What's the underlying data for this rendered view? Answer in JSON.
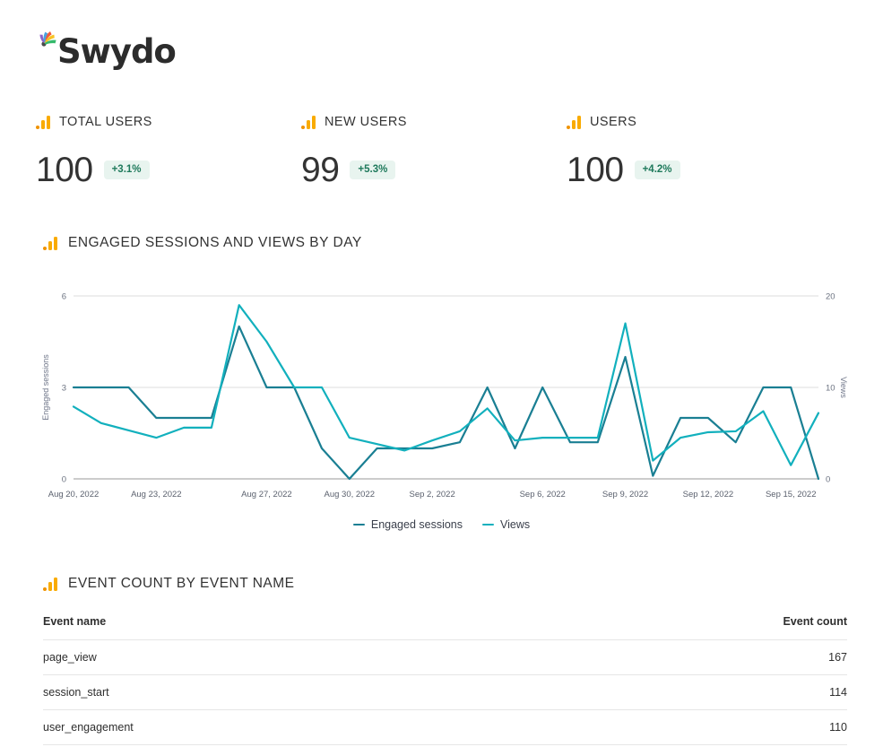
{
  "brand": {
    "name": "Swydo"
  },
  "kpis": [
    {
      "icon": "ga4-bar-icon",
      "title": "TOTAL USERS",
      "value": "100",
      "delta": "+3.1%"
    },
    {
      "icon": "ga4-bar-icon",
      "title": "NEW USERS",
      "value": "99",
      "delta": "+5.3%"
    },
    {
      "icon": "ga4-bar-icon",
      "title": "USERS",
      "value": "100",
      "delta": "+4.2%"
    }
  ],
  "chart_section": {
    "icon": "ga4-bar-icon",
    "title": "ENGAGED SESSIONS AND VIEWS BY DAY"
  },
  "table_section": {
    "icon": "ga4-bar-icon",
    "title": "EVENT COUNT BY EVENT NAME"
  },
  "chart_data": {
    "type": "line",
    "title": "Engaged sessions and views by day",
    "xlabel": "",
    "ylabel": "Engaged sessions",
    "y2label": "Views",
    "ylim": [
      0,
      6
    ],
    "y2lim": [
      0,
      20
    ],
    "yticks": [
      "0",
      "3",
      "6"
    ],
    "y2ticks": [
      "0",
      "10",
      "20"
    ],
    "grid": true,
    "legend_position": "bottom",
    "x": [
      "Aug 20, 2022",
      "Aug 21, 2022",
      "Aug 22, 2022",
      "Aug 23, 2022",
      "Aug 24, 2022",
      "Aug 25, 2022",
      "Aug 26, 2022",
      "Aug 27, 2022",
      "Aug 28, 2022",
      "Aug 29, 2022",
      "Aug 30, 2022",
      "Aug 31, 2022",
      "Sep 1, 2022",
      "Sep 2, 2022",
      "Sep 3, 2022",
      "Sep 4, 2022",
      "Sep 5, 2022",
      "Sep 6, 2022",
      "Sep 7, 2022",
      "Sep 8, 2022",
      "Sep 9, 2022",
      "Sep 10, 2022",
      "Sep 11, 2022",
      "Sep 12, 2022",
      "Sep 13, 2022",
      "Sep 14, 2022",
      "Sep 15, 2022",
      "Sep 16, 2022"
    ],
    "xtick_labels": [
      "Aug 20, 2022",
      "Aug 23, 2022",
      "Aug 27, 2022",
      "Aug 30, 2022",
      "Sep 2, 2022",
      "Sep 6, 2022",
      "Sep 9, 2022",
      "Sep 12, 2022",
      "Sep 15, 2022"
    ],
    "xtick_indices": [
      0,
      3,
      7,
      10,
      13,
      17,
      20,
      23,
      26
    ],
    "series": [
      {
        "name": "Engaged sessions",
        "color": "#1a7f93",
        "axis": "left",
        "values": [
          3,
          3,
          3,
          2,
          2,
          2,
          5,
          3,
          3,
          1,
          0,
          1,
          1,
          1,
          1.2,
          3,
          1,
          3,
          1.2,
          1.2,
          4,
          0.1,
          2,
          2,
          1.2,
          3,
          3,
          0
        ]
      },
      {
        "name": "Views",
        "color": "#12b0bd",
        "axis": "right",
        "values": [
          7.9,
          6.1,
          5.3,
          4.5,
          5.6,
          5.6,
          19,
          15,
          10,
          10,
          4.5,
          3.8,
          3.1,
          4.2,
          5.2,
          7.7,
          4.2,
          4.5,
          4.5,
          4.5,
          17,
          2,
          4.5,
          5.1,
          5.2,
          7.4,
          1.5,
          7.2
        ]
      }
    ]
  },
  "table": {
    "columns": [
      {
        "key": "event_name",
        "label": "Event name",
        "align": "left"
      },
      {
        "key": "event_count",
        "label": "Event count",
        "align": "right"
      }
    ],
    "rows": [
      {
        "event_name": "page_view",
        "event_count": "167"
      },
      {
        "event_name": "session_start",
        "event_count": "114"
      },
      {
        "event_name": "user_engagement",
        "event_count": "110"
      }
    ]
  },
  "colors": {
    "engaged_sessions": "#1a7f93",
    "views": "#12b0bd",
    "badge_bg": "#e8f4ef",
    "badge_text": "#1f7a5c",
    "ga_icon_orange": "#f9ab00",
    "ga_icon_dot": "#f09300"
  }
}
